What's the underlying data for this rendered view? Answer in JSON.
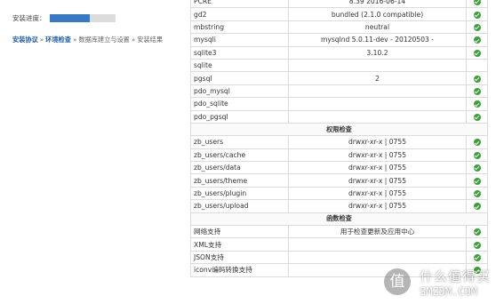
{
  "progress": {
    "label": "安装进度：",
    "fraction": 0.62
  },
  "steps": [
    {
      "label": "安装协议",
      "done": true
    },
    {
      "label": "环境检查",
      "done": true
    },
    {
      "label": "数据库建立与设置",
      "done": false
    },
    {
      "label": "安装结果",
      "done": false
    }
  ],
  "step_separator": "»",
  "rows": [
    {
      "type": "row",
      "name": "PCRE",
      "value": "8.39 2016-06-14",
      "ok": true
    },
    {
      "type": "row",
      "name": "gd2",
      "value": "bundled (2.1.0 compatible)",
      "ok": true
    },
    {
      "type": "row",
      "name": "mbstring",
      "value": "neutral",
      "ok": true
    },
    {
      "type": "row",
      "name": "mysqli",
      "value": "mysqlnd 5.0.11-dev - 20120503 -",
      "ok": true
    },
    {
      "type": "row",
      "name": "sqlite3",
      "value": "3.10.2",
      "ok": true
    },
    {
      "type": "row",
      "name": "sqlite",
      "value": "",
      "ok": false
    },
    {
      "type": "row",
      "name": "pgsql",
      "value": "2",
      "ok": true
    },
    {
      "type": "row",
      "name": "pdo_mysql",
      "value": "",
      "ok": true
    },
    {
      "type": "row",
      "name": "pdo_sqlite",
      "value": "",
      "ok": true
    },
    {
      "type": "row",
      "name": "pdo_pgsql",
      "value": "",
      "ok": true
    },
    {
      "type": "section",
      "title": "权限检查"
    },
    {
      "type": "row",
      "name": "zb_users",
      "value": "drwxr-xr-x | 0755",
      "ok": true
    },
    {
      "type": "row",
      "name": "zb_users/cache",
      "value": "drwxr-xr-x | 0755",
      "ok": true
    },
    {
      "type": "row",
      "name": "zb_users/data",
      "value": "drwxr-xr-x | 0755",
      "ok": true
    },
    {
      "type": "row",
      "name": "zb_users/theme",
      "value": "drwxr-xr-x | 0755",
      "ok": true
    },
    {
      "type": "row",
      "name": "zb_users/plugin",
      "value": "drwxr-xr-x | 0755",
      "ok": true
    },
    {
      "type": "row",
      "name": "zb_users/upload",
      "value": "drwxr-xr-x | 0755",
      "ok": true
    },
    {
      "type": "section",
      "title": "函数检查"
    },
    {
      "type": "row",
      "name": "网络支持",
      "value": "用于检查更新及应用中心",
      "ok": true
    },
    {
      "type": "row",
      "name": "XML支持",
      "value": "",
      "ok": true
    },
    {
      "type": "row",
      "name": "JSON支持",
      "value": "",
      "ok": true
    },
    {
      "type": "row",
      "name": "iconv编码转换支持",
      "value": "",
      "ok": true
    }
  ],
  "watermark": {
    "logo": "值",
    "cn": "什么值得买",
    "en": "SMZDM.COM"
  },
  "colors": {
    "progress_fill": "#3a78c2",
    "step_done": "#1f5aa6",
    "check_ok": "#3aa03a"
  }
}
